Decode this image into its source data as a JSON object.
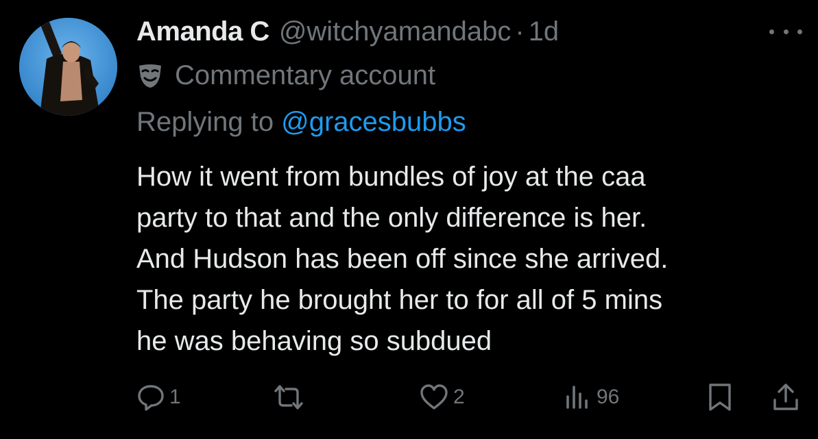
{
  "author": {
    "display_name": "Amanda C",
    "handle": "@witchyamandabc",
    "separator": "·",
    "time": "1d"
  },
  "label": {
    "icon": "theater-mask-icon",
    "text": "Commentary account"
  },
  "reply": {
    "prefix": "Replying to",
    "handle": "@gracesbubbs"
  },
  "body": {
    "lines": [
      "How it went from bundles of joy at the caa",
      "party to that and the only difference is her.",
      "And Hudson has been off since she arrived.",
      "The party he brought her to for all of 5 mins",
      "he was behaving so subdued"
    ]
  },
  "actions": {
    "reply_count": "1",
    "repost_count": "",
    "like_count": "2",
    "views_count": "96"
  },
  "colors": {
    "background": "#000000",
    "text_primary": "#e7e9ea",
    "text_secondary": "#71767b",
    "link": "#1d9bf0"
  }
}
